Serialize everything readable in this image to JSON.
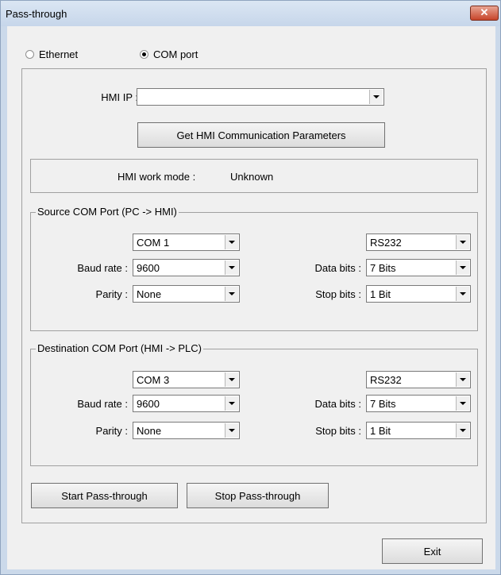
{
  "window": {
    "title": "Pass-through",
    "close_glyph": "✕"
  },
  "connection": {
    "ethernet_label": "Ethernet",
    "com_port_label": "COM port",
    "selected": "COM port"
  },
  "hmi": {
    "ip_label": "HMI IP :",
    "ip_value": "",
    "get_params_label": "Get HMI  Communication Parameters",
    "work_mode_label": "HMI work mode :",
    "work_mode_value": "Unknown"
  },
  "source": {
    "title": "Source COM Port (PC -> HMI)",
    "port": "COM 1",
    "interface": "RS232",
    "baud_label": "Baud rate :",
    "baud": "9600",
    "databits_label": "Data bits :",
    "databits": "7 Bits",
    "parity_label": "Parity :",
    "parity": "None",
    "stopbits_label": "Stop bits :",
    "stopbits": "1 Bit"
  },
  "destination": {
    "title": "Destination COM Port (HMI -> PLC)",
    "port": "COM 3",
    "interface": "RS232",
    "baud_label": "Baud rate :",
    "baud": "9600",
    "databits_label": "Data bits :",
    "databits": "7 Bits",
    "parity_label": "Parity :",
    "parity": "None",
    "stopbits_label": "Stop bits :",
    "stopbits": "1 Bit"
  },
  "actions": {
    "start_label": "Start Pass-through",
    "stop_label": "Stop Pass-through",
    "exit_label": "Exit"
  }
}
